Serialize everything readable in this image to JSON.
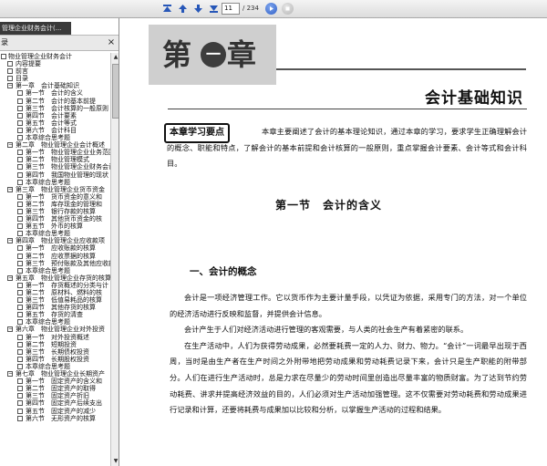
{
  "toolbar": {
    "page_value": "11",
    "page_total": "/ 234"
  },
  "left_panel": {
    "doc_tab_label": "管理企业财务会计(...",
    "header_label": "录",
    "tree": [
      {
        "level": 0,
        "label": "物业管理企业财务会计"
      },
      {
        "level": 1,
        "label": "内容提要"
      },
      {
        "level": 1,
        "label": "前言"
      },
      {
        "level": 1,
        "label": "目录"
      },
      {
        "level": 1,
        "label": "第一章　会计基础知识",
        "expander": true
      },
      {
        "level": 2,
        "label": "第一节　会计的含义"
      },
      {
        "level": 2,
        "label": "第二节　会计的基本前提"
      },
      {
        "level": 2,
        "label": "第三节　会计核算的一般原则"
      },
      {
        "level": 2,
        "label": "第四节　会计要素"
      },
      {
        "level": 2,
        "label": "第五节　会计等式"
      },
      {
        "level": 2,
        "label": "第六节　会计科目"
      },
      {
        "level": 2,
        "label": "本章综合思考题"
      },
      {
        "level": 1,
        "label": "第二章　物业管理企业会计概述",
        "expander": true
      },
      {
        "level": 2,
        "label": "第一节　物业管理企业业务范围"
      },
      {
        "level": 2,
        "label": "第二节　物业管理模式"
      },
      {
        "level": 2,
        "label": "第三节　物业管理企业财务会计"
      },
      {
        "level": 2,
        "label": "第四节　我国物业管理的现状"
      },
      {
        "level": 2,
        "label": "本章综合思考题"
      },
      {
        "level": 1,
        "label": "第三章　物业管理企业货币资金",
        "expander": true
      },
      {
        "level": 2,
        "label": "第一节　货币资金的意义和"
      },
      {
        "level": 2,
        "label": "第二节　库存现金的管理和"
      },
      {
        "level": 2,
        "label": "第三节　银行存款的核算"
      },
      {
        "level": 2,
        "label": "第四节　其他货币资金的核"
      },
      {
        "level": 2,
        "label": "第五节　外币的核算"
      },
      {
        "level": 2,
        "label": "本章综合思考题"
      },
      {
        "level": 1,
        "label": "第四章　物业管理企业应收款项",
        "expander": true
      },
      {
        "level": 2,
        "label": "第一节　应收账款的核算"
      },
      {
        "level": 2,
        "label": "第二节　应收票据的核算"
      },
      {
        "level": 2,
        "label": "第三节　预付账款及其他应收款"
      },
      {
        "level": 2,
        "label": "本章综合思考题"
      },
      {
        "level": 1,
        "label": "第五章　物业管理企业存货的核算",
        "expander": true
      },
      {
        "level": 2,
        "label": "第一节　存货概述的分类与计"
      },
      {
        "level": 2,
        "label": "第二节　原材料、燃料的核"
      },
      {
        "level": 2,
        "label": "第三节　低值易耗品的核算"
      },
      {
        "level": 2,
        "label": "第四节　其他存货的核算"
      },
      {
        "level": 2,
        "label": "第五节　存货的清查"
      },
      {
        "level": 2,
        "label": "本章综合思考题"
      },
      {
        "level": 1,
        "label": "第六章　物业管理企业对外投资",
        "expander": true
      },
      {
        "level": 2,
        "label": "第一节　对外投资概述"
      },
      {
        "level": 2,
        "label": "第二节　短期投资"
      },
      {
        "level": 2,
        "label": "第三节　长期债权投资"
      },
      {
        "level": 2,
        "label": "第四节　长期股权投资"
      },
      {
        "level": 2,
        "label": "本章综合思考题"
      },
      {
        "level": 1,
        "label": "第七章　物业管理企业长期资产",
        "expander": true
      },
      {
        "level": 2,
        "label": "第一节　固定资产的含义和"
      },
      {
        "level": 2,
        "label": "第二节　固定资产的取得"
      },
      {
        "level": 2,
        "label": "第三节　固定资产折旧"
      },
      {
        "level": 2,
        "label": "第四节　固定资产后续支出"
      },
      {
        "level": 2,
        "label": "第五节　固定资产的减少"
      },
      {
        "level": 2,
        "label": "第六节　无形资产的核算"
      }
    ]
  },
  "document": {
    "chapter_char_a": "第",
    "chapter_char_b": "一",
    "chapter_char_c": "章",
    "chapter_title": "会计基础知识",
    "key_points_label": "本章学习要点",
    "intro": "本章主要阐述了会计的基本理论知识，通过本章的学习，要求学生正确理解会计的概念、职能和特点，了解会计的基本前提和会计核算的一般原则，重点掌握会计要素、会计等式和会计科目。",
    "section_title": "第一节　会计的含义",
    "sub_title": "一、会计的概念",
    "paragraphs": [
      "会计是一项经济管理工作。它以货币作为主要计量手段，以凭证为依据，采用专门的方法，对一个单位的经济活动进行反映和监督，并提供会计信息。",
      "会计产生于人们对经济活动进行管理的客观需要，与人类的社会生产有着紧密的联系。",
      "在生产活动中，人们为获得劳动成果，必然要耗费一定的人力、财力、物力。“会计”一词最早出现于西周，当时是由生产者在生产时间之外附带地把劳动成果和劳动耗费记录下来，会计只是生产职能的附带部分。人们在进行生产活动时，总是力求在尽量少的劳动时间里创造出尽量丰富的物质财富。为了达到节约劳动耗费、讲求并提高经济效益的目的，人们必须对生产活动加强管理。这不仅需要对劳动耗费和劳动成果进行记录和计算，还要将耗费与成果加以比较和分析，以掌握生产活动的过程和结果。"
    ]
  }
}
